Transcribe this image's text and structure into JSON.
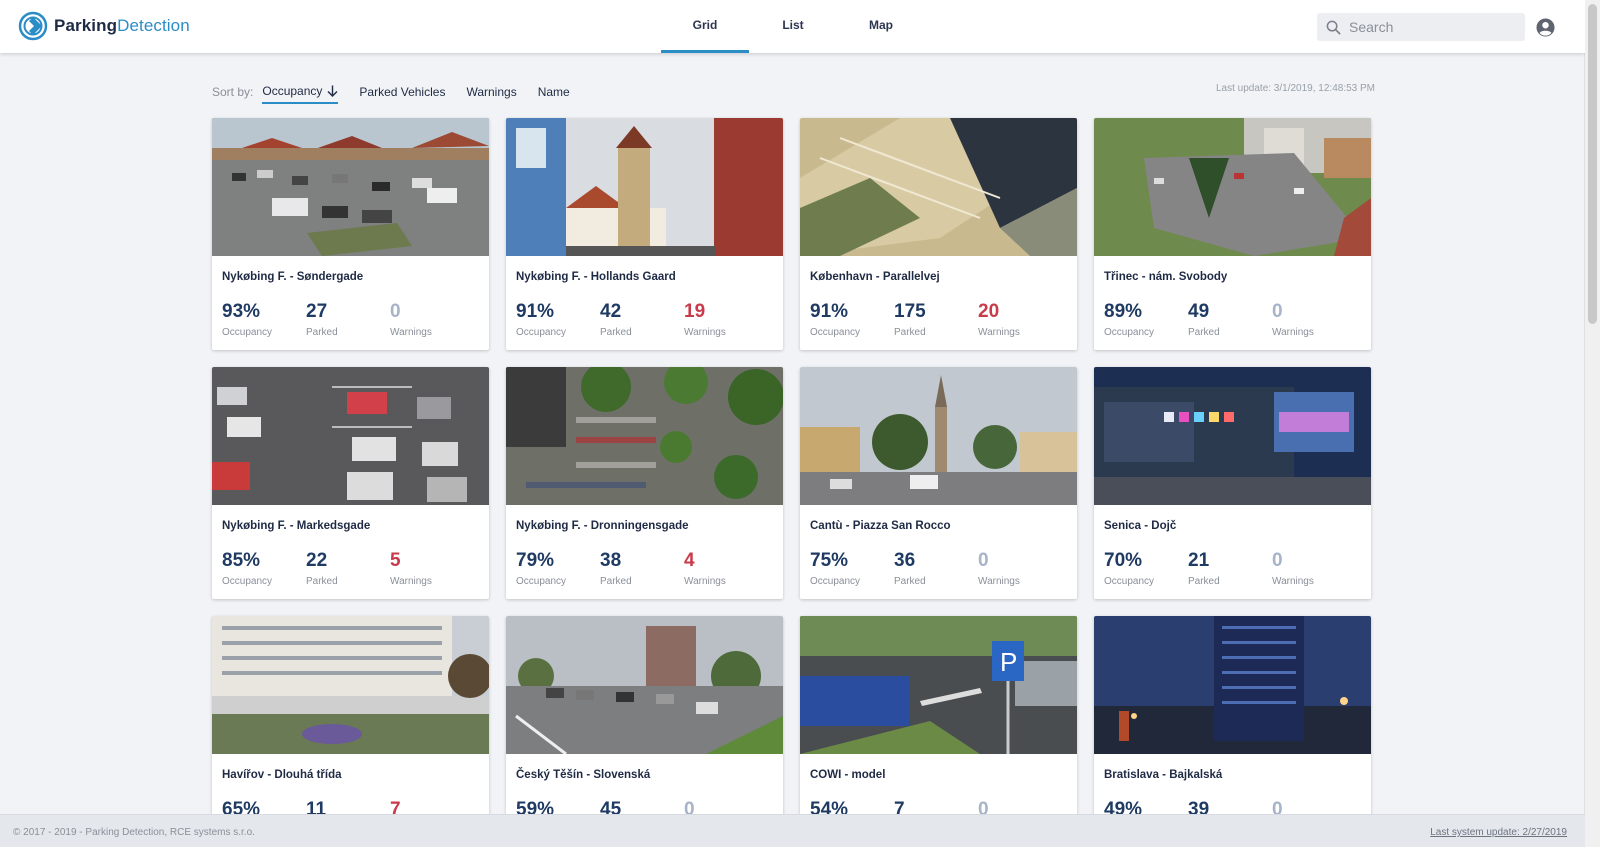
{
  "header": {
    "logo_bold": "Parking",
    "logo_light": "Detection",
    "tabs": [
      {
        "label": "Grid",
        "active": true
      },
      {
        "label": "List",
        "active": false
      },
      {
        "label": "Map",
        "active": false
      }
    ],
    "search_placeholder": "Search",
    "accent_color": "#2b8dc6"
  },
  "sort": {
    "label": "Sort by:",
    "options": [
      "Occupancy",
      "Parked Vehicles",
      "Warnings",
      "Name"
    ],
    "active": "Occupancy"
  },
  "last_update": "Last update: 3/1/2019, 12:48:53 PM",
  "labels": {
    "occupancy": "Occupancy",
    "parked": "Parked",
    "warnings": "Warnings"
  },
  "cards": [
    {
      "name": "Nykøbing F. - Søndergade",
      "occupancy": "93%",
      "parked": "27",
      "warnings": "0"
    },
    {
      "name": "Nykøbing F. - Hollands Gaard",
      "occupancy": "91%",
      "parked": "42",
      "warnings": "19"
    },
    {
      "name": "København - Parallelvej",
      "occupancy": "91%",
      "parked": "175",
      "warnings": "20"
    },
    {
      "name": "Třinec - nám. Svobody",
      "occupancy": "89%",
      "parked": "49",
      "warnings": "0"
    },
    {
      "name": "Nykøbing F. - Markedsgade",
      "occupancy": "85%",
      "parked": "22",
      "warnings": "5"
    },
    {
      "name": "Nykøbing F. - Dronningensgade",
      "occupancy": "79%",
      "parked": "38",
      "warnings": "4"
    },
    {
      "name": "Cantù - Piazza San Rocco",
      "occupancy": "75%",
      "parked": "36",
      "warnings": "0"
    },
    {
      "name": "Senica - Dojč",
      "occupancy": "70%",
      "parked": "21",
      "warnings": "0"
    },
    {
      "name": "Havířov - Dlouhá třída",
      "occupancy": "65%",
      "parked": "11",
      "warnings": "7"
    },
    {
      "name": "Český Těšín - Slovenská",
      "occupancy": "59%",
      "parked": "45",
      "warnings": "0"
    },
    {
      "name": "COWI - model",
      "occupancy": "54%",
      "parked": "7",
      "warnings": "0"
    },
    {
      "name": "Bratislava - Bajkalská",
      "occupancy": "49%",
      "parked": "39",
      "warnings": "0"
    }
  ],
  "footer": {
    "copyright": "© 2017 - 2019 - Parking Detection, RCE systems s.r.o.",
    "system_update": "Last system update: 2/27/2019"
  },
  "colors": {
    "warning": "#c93a4a",
    "value": "#1f3b63",
    "zero": "#a7b3c8"
  }
}
